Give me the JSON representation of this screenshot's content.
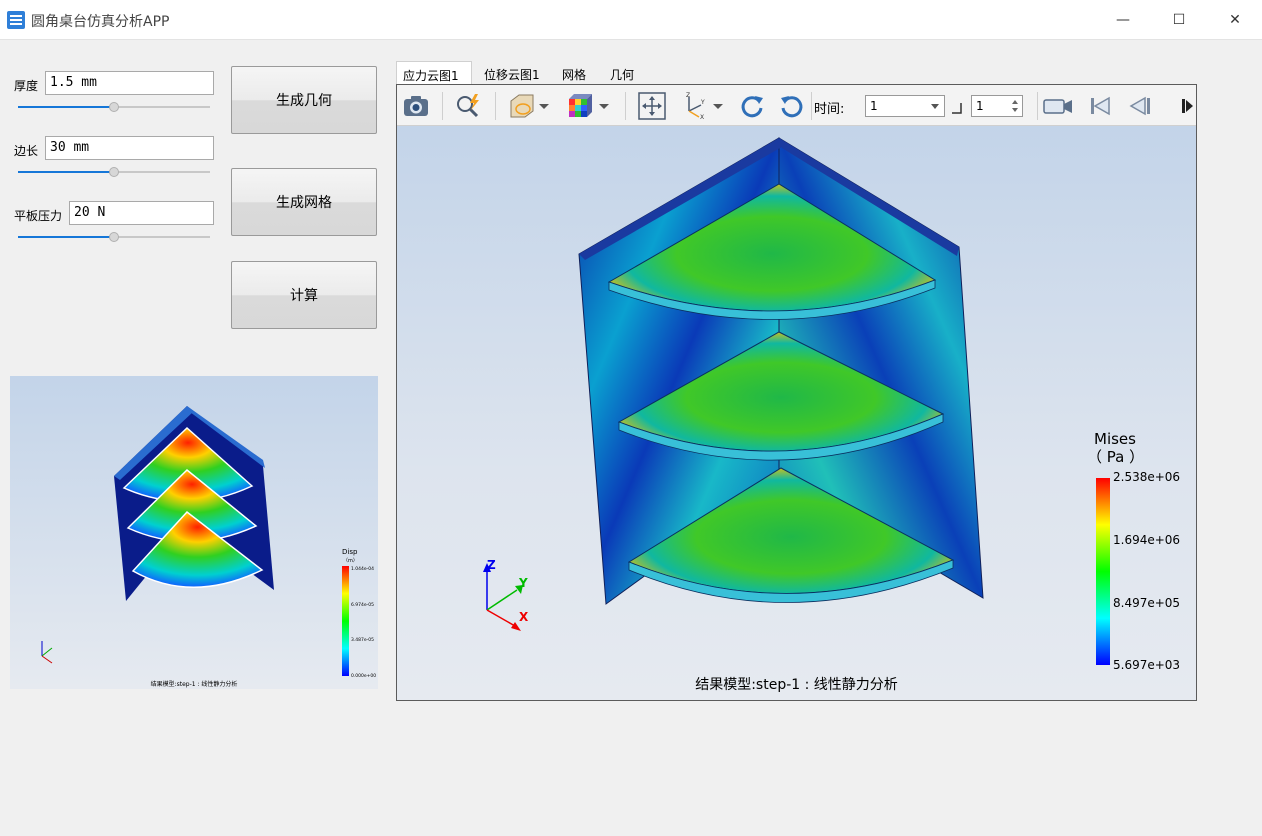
{
  "window": {
    "title": "圆角桌台仿真分析APP",
    "minimize": "—",
    "maximize": "☐",
    "close": "✕"
  },
  "params": {
    "thickness": {
      "label": "厚度",
      "value": "1.5 mm",
      "slider": 0.5
    },
    "edge": {
      "label": "边长",
      "value": "30 mm",
      "slider": 0.5
    },
    "pressure": {
      "label": "平板压力",
      "value": "20 N",
      "slider": 0.5
    }
  },
  "actions": {
    "gen_geometry": "生成几何",
    "gen_mesh": "生成网格",
    "compute": "计算"
  },
  "thumbnail": {
    "legend_title": "Disp",
    "legend_unit": "（m）",
    "legend_values": [
      "1.044e-04",
      "6.974e-05",
      "3.487e-05",
      "0.000e+00"
    ],
    "caption": "结果模型:step-1 : 线性静力分析"
  },
  "tabs": [
    "应力云图1",
    "位移云图1",
    "网格",
    "几何"
  ],
  "active_tab": 0,
  "toolbar": {
    "time_label": "时间:",
    "time_value": "1",
    "step_value": "1"
  },
  "viewer": {
    "caption": "结果模型:step-1 : 线性静力分析",
    "legend_title": "Mises",
    "legend_unit": "（ Pa ）",
    "legend_values": [
      "2.538e+06",
      "1.694e+06",
      "8.497e+05",
      "5.697e+03"
    ],
    "axes": {
      "x": "X",
      "y": "Y",
      "z": "Z"
    }
  },
  "colors": {
    "accent": "#1677d8",
    "stress_max": "#ff0000",
    "stress_min": "#0000ff"
  }
}
